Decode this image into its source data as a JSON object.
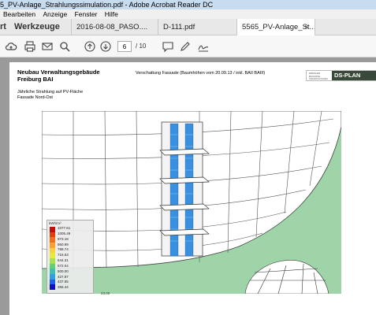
{
  "window": {
    "title": "5_PV-Anlage_Strahlungssimulation.pdf - Adobe Acrobat Reader DC"
  },
  "menu": {
    "items": [
      "Bearbeiten",
      "Anzeige",
      "Fenster",
      "Hilfe"
    ]
  },
  "tabs": {
    "start_label": "rt",
    "tools_label": "Werkzeuge",
    "documents": [
      "2016-08-08_PASO....",
      "D-111.pdf",
      "5565_PV-Anlage_St..."
    ],
    "close_glyph": "×"
  },
  "toolbar": {
    "icons": [
      "upload-cloud-icon",
      "print-icon",
      "mail-icon",
      "search-icon",
      "page-up-icon",
      "page-down-icon",
      "comment-icon",
      "pen-icon",
      "sign-icon"
    ],
    "current_page": "6",
    "total_pages": "/ 10"
  },
  "document": {
    "title_line1": "Neubau Verwaltungsgebäude",
    "title_line2": "Freiburg BAI",
    "header_center": "Verschattung Fassade (Baumhöhen vom 20.09.13 / inkl. BAII BAIII)",
    "note_line1": "Jährliche Strahlung auf PV-Fläche",
    "note_line2": "Fassade Nord-Ost",
    "logo_small_text": "DREXLER BUILDING TECHNOLOGIES",
    "logo_text": "DS-PLAN"
  },
  "legend": {
    "unit": "kWh/m²",
    "values": [
      "1077.61",
      "1005.49",
      "973.18",
      "860.99",
      "788.74",
      "716.63",
      "644.31",
      "572.04",
      "500.00",
      "427.87",
      "437.65",
      "355.44"
    ],
    "colors": [
      "#c01010",
      "#e04010",
      "#f07020",
      "#f8a030",
      "#f8d040",
      "#e8e840",
      "#a8e050",
      "#60d070",
      "#40c0b0",
      "#30a0e0",
      "#2060f0",
      "#1010c0"
    ],
    "footer": "23.00"
  },
  "colors": {
    "ground": "#9ed4a8",
    "facade_stripes": "#3a90e0",
    "background_gray": "#9a9a9a"
  }
}
